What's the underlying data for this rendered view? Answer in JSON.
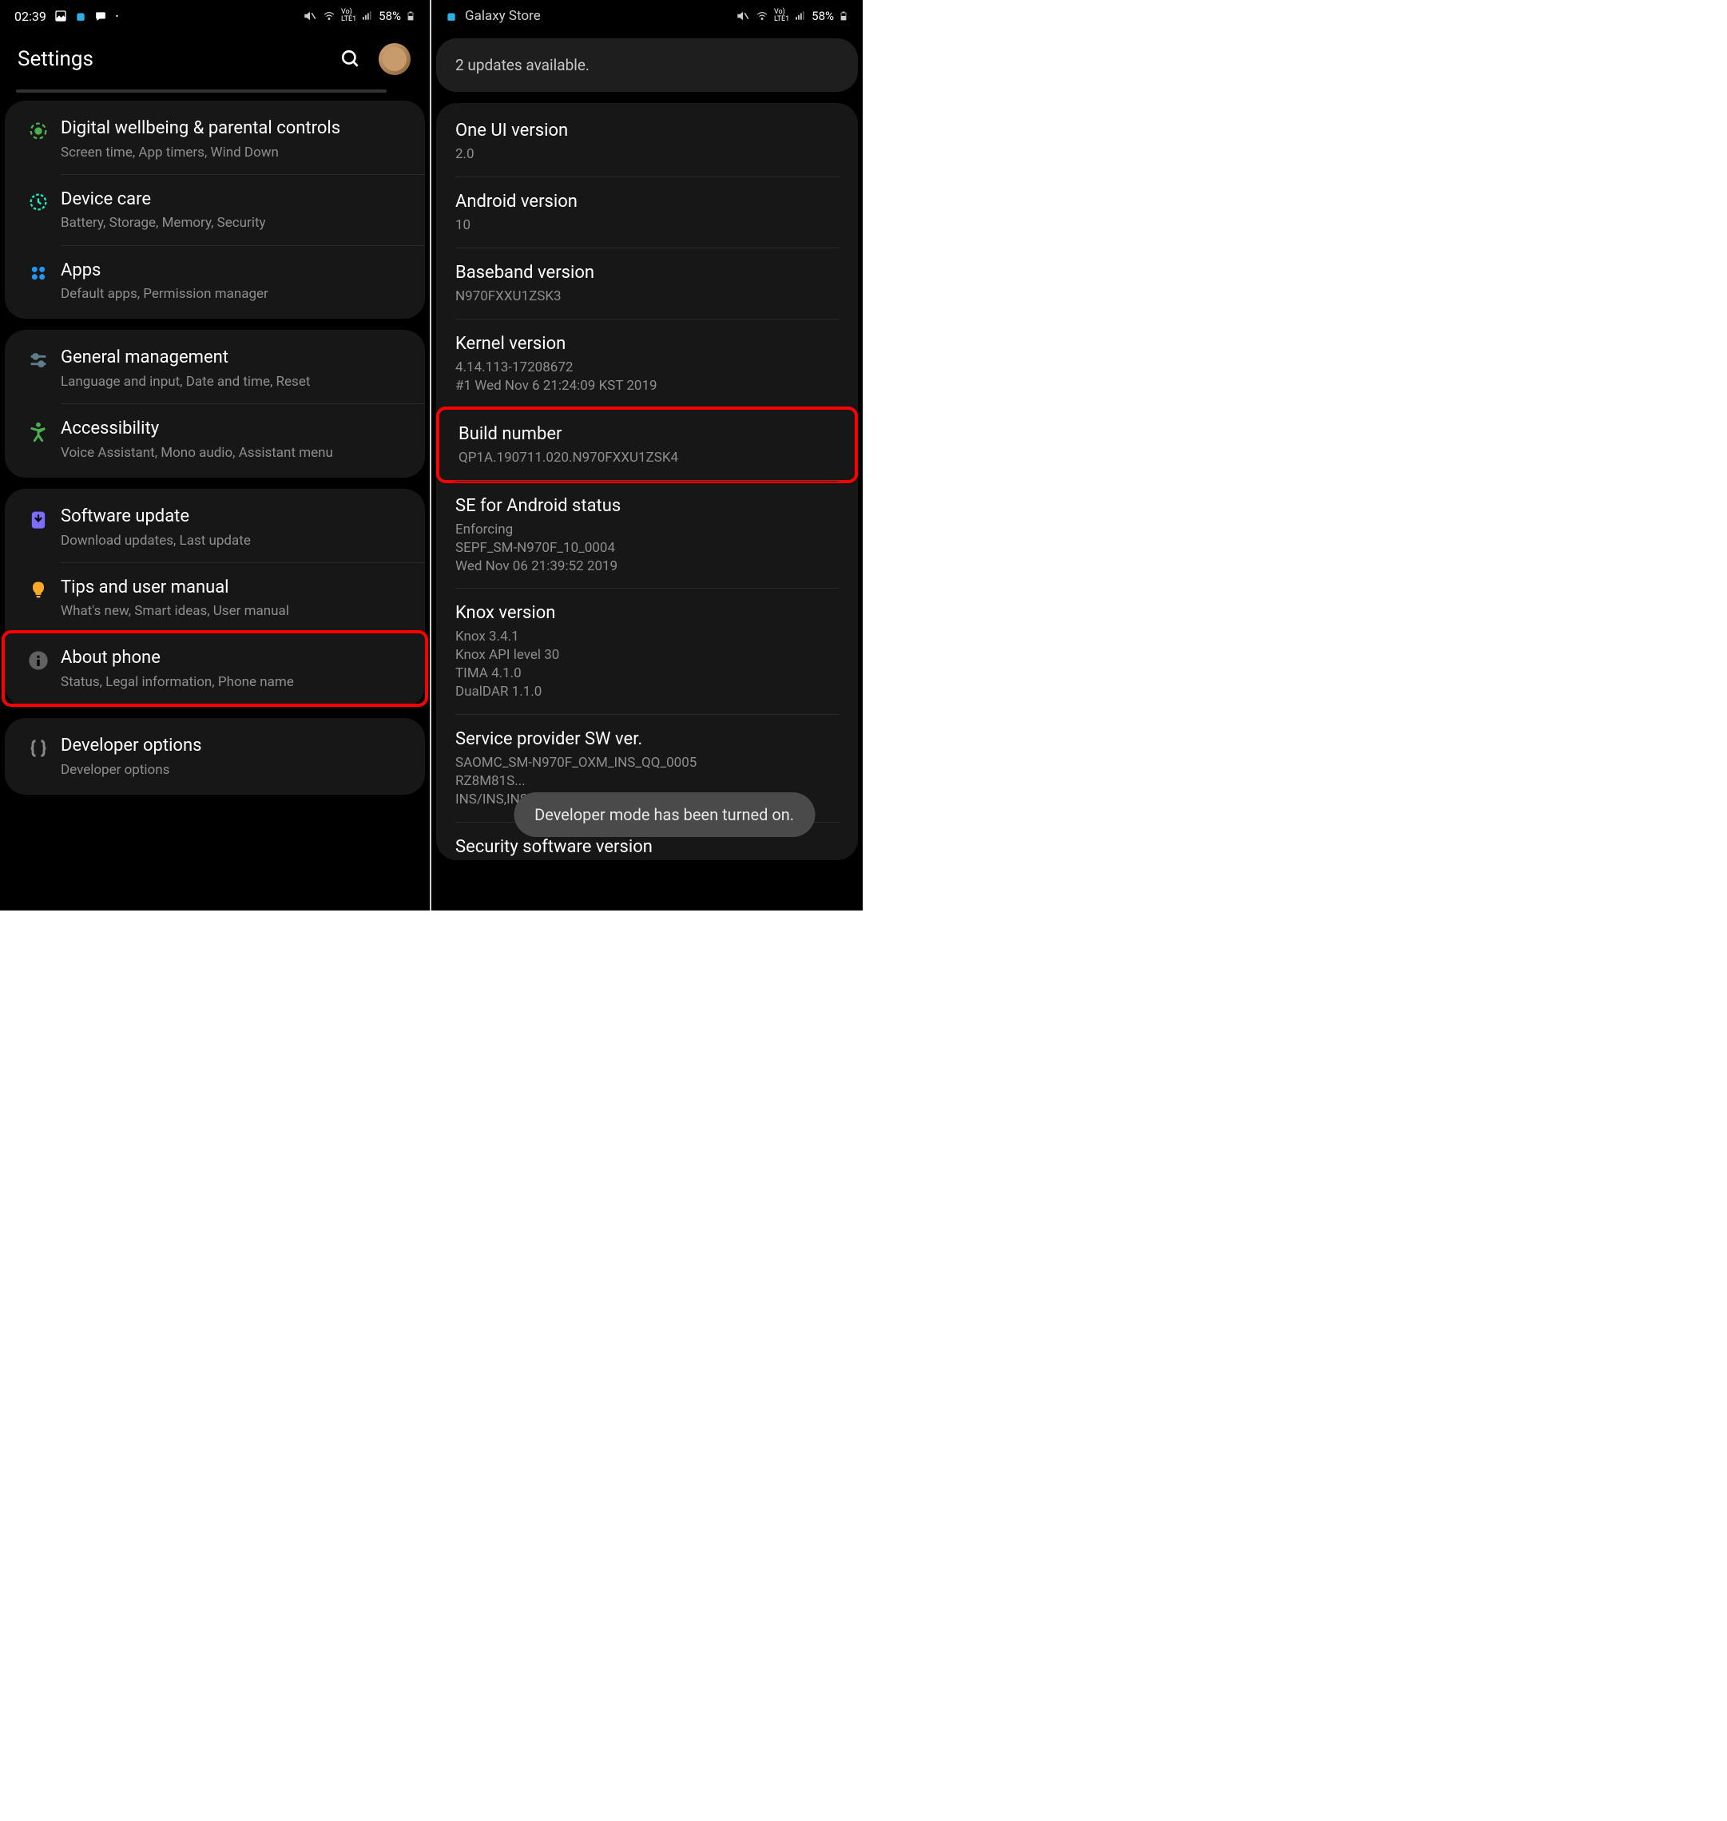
{
  "statusBar": {
    "time": "02:39",
    "battery": "58%",
    "network": "Vo LTE1",
    "galaxyStore": "Galaxy Store"
  },
  "left": {
    "title": "Settings",
    "items": [
      {
        "title": "Digital wellbeing & parental controls",
        "sub": "Screen time, App timers, Wind Down"
      },
      {
        "title": "Device care",
        "sub": "Battery, Storage, Memory, Security"
      },
      {
        "title": "Apps",
        "sub": "Default apps, Permission manager"
      },
      {
        "title": "General management",
        "sub": "Language and input, Date and time, Reset"
      },
      {
        "title": "Accessibility",
        "sub": "Voice Assistant, Mono audio, Assistant menu"
      },
      {
        "title": "Software update",
        "sub": "Download updates, Last update"
      },
      {
        "title": "Tips and user manual",
        "sub": "What's new, Smart ideas, User manual"
      },
      {
        "title": "About phone",
        "sub": "Status, Legal information, Phone name"
      },
      {
        "title": "Developer options",
        "sub": "Developer options"
      }
    ]
  },
  "right": {
    "banner": "2 updates available.",
    "info": [
      {
        "title": "One UI version",
        "sub": "2.0"
      },
      {
        "title": "Android version",
        "sub": "10"
      },
      {
        "title": "Baseband version",
        "sub": "N970FXXU1ZSK3"
      },
      {
        "title": "Kernel version",
        "sub": "4.14.113-17208672\n#1 Wed Nov 6 21:24:09 KST 2019"
      },
      {
        "title": "Build number",
        "sub": "QP1A.190711.020.N970FXXU1ZSK4"
      },
      {
        "title": "SE for Android status",
        "sub": "Enforcing\nSEPF_SM-N970F_10_0004\nWed Nov 06 21:39:52 2019"
      },
      {
        "title": "Knox version",
        "sub": "Knox 3.4.1\nKnox API level 30\nTIMA 4.1.0\nDualDAR 1.1.0"
      },
      {
        "title": "Service provider SW ver.",
        "sub": "SAOMC_SM-N970F_OXM_INS_QQ_0005\nRZ8M81S...\nINS/INS,INS/INS"
      },
      {
        "title": "Security software version",
        "sub": ""
      }
    ],
    "toast": "Developer mode has been turned on."
  }
}
